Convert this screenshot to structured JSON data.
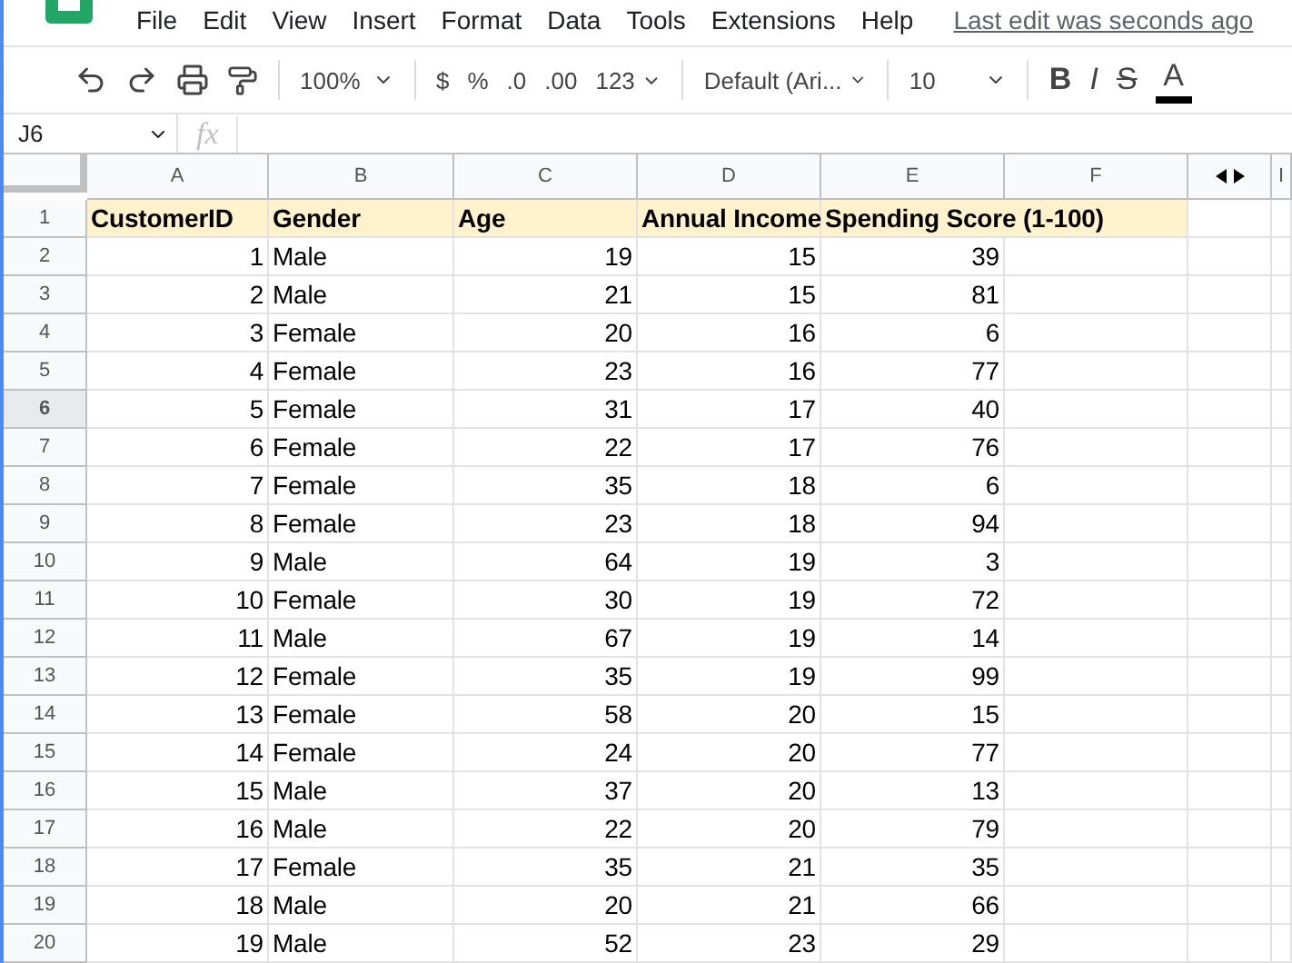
{
  "menu": [
    "File",
    "Edit",
    "View",
    "Insert",
    "Format",
    "Data",
    "Tools",
    "Extensions",
    "Help"
  ],
  "last_edit": "Last edit was seconds ago",
  "toolbar": {
    "zoom": "100%",
    "currency": "$",
    "percent": "%",
    "decrease_decimals": ".0",
    "increase_decimals": ".00",
    "more_formats": "123",
    "font": "Default (Ari...",
    "font_size": "10",
    "bold": "B",
    "italic": "I",
    "strikethrough": "S",
    "text_color": "A"
  },
  "name_box": "J6",
  "formula_label": "fx",
  "columns": [
    "A",
    "B",
    "C",
    "D",
    "E",
    "F",
    "",
    "I"
  ],
  "rows": [
    {
      "number": "1",
      "selected": false,
      "header": true,
      "cells": [
        "CustomerID",
        "Gender",
        "Age",
        "Annual Income",
        "Spending Score (1-100)"
      ]
    },
    {
      "number": "2",
      "selected": false,
      "cells": [
        "1",
        "Male",
        "19",
        "15",
        "39"
      ]
    },
    {
      "number": "3",
      "selected": false,
      "cells": [
        "2",
        "Male",
        "21",
        "15",
        "81"
      ]
    },
    {
      "number": "4",
      "selected": false,
      "cells": [
        "3",
        "Female",
        "20",
        "16",
        "6"
      ]
    },
    {
      "number": "5",
      "selected": false,
      "cells": [
        "4",
        "Female",
        "23",
        "16",
        "77"
      ]
    },
    {
      "number": "6",
      "selected": true,
      "cells": [
        "5",
        "Female",
        "31",
        "17",
        "40"
      ]
    },
    {
      "number": "7",
      "selected": false,
      "cells": [
        "6",
        "Female",
        "22",
        "17",
        "76"
      ]
    },
    {
      "number": "8",
      "selected": false,
      "cells": [
        "7",
        "Female",
        "35",
        "18",
        "6"
      ]
    },
    {
      "number": "9",
      "selected": false,
      "cells": [
        "8",
        "Female",
        "23",
        "18",
        "94"
      ]
    },
    {
      "number": "10",
      "selected": false,
      "cells": [
        "9",
        "Male",
        "64",
        "19",
        "3"
      ]
    },
    {
      "number": "11",
      "selected": false,
      "cells": [
        "10",
        "Female",
        "30",
        "19",
        "72"
      ]
    },
    {
      "number": "12",
      "selected": false,
      "cells": [
        "11",
        "Male",
        "67",
        "19",
        "14"
      ]
    },
    {
      "number": "13",
      "selected": false,
      "cells": [
        "12",
        "Female",
        "35",
        "19",
        "99"
      ]
    },
    {
      "number": "14",
      "selected": false,
      "cells": [
        "13",
        "Female",
        "58",
        "20",
        "15"
      ]
    },
    {
      "number": "15",
      "selected": false,
      "cells": [
        "14",
        "Female",
        "24",
        "20",
        "77"
      ]
    },
    {
      "number": "16",
      "selected": false,
      "cells": [
        "15",
        "Male",
        "37",
        "20",
        "13"
      ]
    },
    {
      "number": "17",
      "selected": false,
      "cells": [
        "16",
        "Male",
        "22",
        "20",
        "79"
      ]
    },
    {
      "number": "18",
      "selected": false,
      "cells": [
        "17",
        "Female",
        "35",
        "21",
        "35"
      ]
    },
    {
      "number": "19",
      "selected": false,
      "cells": [
        "18",
        "Male",
        "20",
        "21",
        "66"
      ]
    },
    {
      "number": "20",
      "selected": false,
      "cells": [
        "19",
        "Male",
        "52",
        "23",
        "29"
      ]
    }
  ]
}
